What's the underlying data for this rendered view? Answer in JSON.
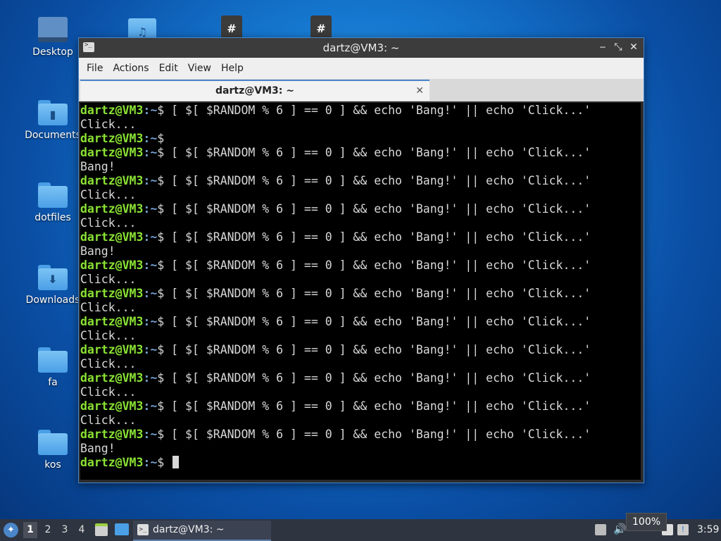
{
  "desktop": {
    "icons": [
      {
        "label": "Desktop"
      },
      {
        "label": "Documents"
      },
      {
        "label": "dotfiles"
      },
      {
        "label": "Downloads"
      },
      {
        "label": "fa"
      },
      {
        "label": "kos"
      }
    ]
  },
  "window": {
    "title": "dartz@VM3: ~",
    "menu": [
      "File",
      "Actions",
      "Edit",
      "View",
      "Help"
    ],
    "tab_label": "dartz@VM3: ~",
    "tab_close": "✕",
    "controls": {
      "minimize": "‒",
      "maximize": "⤡",
      "close": "✕"
    }
  },
  "terminal": {
    "prompt_user": "dartz@VM3",
    "prompt_path": ":~",
    "prompt_sign": "$ ",
    "lines": [
      {
        "type": "cmd",
        "text": "[ $[ $RANDOM % 6 ] == 0 ] && echo 'Bang!' || echo 'Click...'"
      },
      {
        "type": "out",
        "text": "Click..."
      },
      {
        "type": "cmd",
        "text": ""
      },
      {
        "type": "cmd",
        "text": "[ $[ $RANDOM % 6 ] == 0 ] && echo 'Bang!' || echo 'Click...'"
      },
      {
        "type": "out",
        "text": "Bang!"
      },
      {
        "type": "cmd",
        "text": "[ $[ $RANDOM % 6 ] == 0 ] && echo 'Bang!' || echo 'Click...'"
      },
      {
        "type": "out",
        "text": "Click..."
      },
      {
        "type": "cmd",
        "text": "[ $[ $RANDOM % 6 ] == 0 ] && echo 'Bang!' || echo 'Click...'"
      },
      {
        "type": "out",
        "text": "Click..."
      },
      {
        "type": "cmd",
        "text": "[ $[ $RANDOM % 6 ] == 0 ] && echo 'Bang!' || echo 'Click...'"
      },
      {
        "type": "out",
        "text": "Bang!"
      },
      {
        "type": "cmd",
        "text": "[ $[ $RANDOM % 6 ] == 0 ] && echo 'Bang!' || echo 'Click...'"
      },
      {
        "type": "out",
        "text": "Click..."
      },
      {
        "type": "cmd",
        "text": "[ $[ $RANDOM % 6 ] == 0 ] && echo 'Bang!' || echo 'Click...'"
      },
      {
        "type": "out",
        "text": "Click..."
      },
      {
        "type": "cmd",
        "text": "[ $[ $RANDOM % 6 ] == 0 ] && echo 'Bang!' || echo 'Click...'"
      },
      {
        "type": "out",
        "text": "Click..."
      },
      {
        "type": "cmd",
        "text": "[ $[ $RANDOM % 6 ] == 0 ] && echo 'Bang!' || echo 'Click...'"
      },
      {
        "type": "out",
        "text": "Click..."
      },
      {
        "type": "cmd",
        "text": "[ $[ $RANDOM % 6 ] == 0 ] && echo 'Bang!' || echo 'Click...'"
      },
      {
        "type": "out",
        "text": "Click..."
      },
      {
        "type": "cmd",
        "text": "[ $[ $RANDOM % 6 ] == 0 ] && echo 'Bang!' || echo 'Click...'"
      },
      {
        "type": "out",
        "text": "Click..."
      },
      {
        "type": "cmd",
        "text": "[ $[ $RANDOM % 6 ] == 0 ] && echo 'Bang!' || echo 'Click...'"
      },
      {
        "type": "out",
        "text": "Bang!"
      },
      {
        "type": "cmd",
        "text": "",
        "cursor": true
      }
    ]
  },
  "taskbar": {
    "workspaces": [
      "1",
      "2",
      "3",
      "4"
    ],
    "active_workspace": "1",
    "task_label": "dartz@VM3: ~",
    "volume_tooltip": "100%",
    "clock": "3:59"
  },
  "colors": {
    "prompt_user": "#8ae234",
    "prompt_path": "#729fcf",
    "terminal_bg": "#000000",
    "accent": "#4a86c8"
  }
}
